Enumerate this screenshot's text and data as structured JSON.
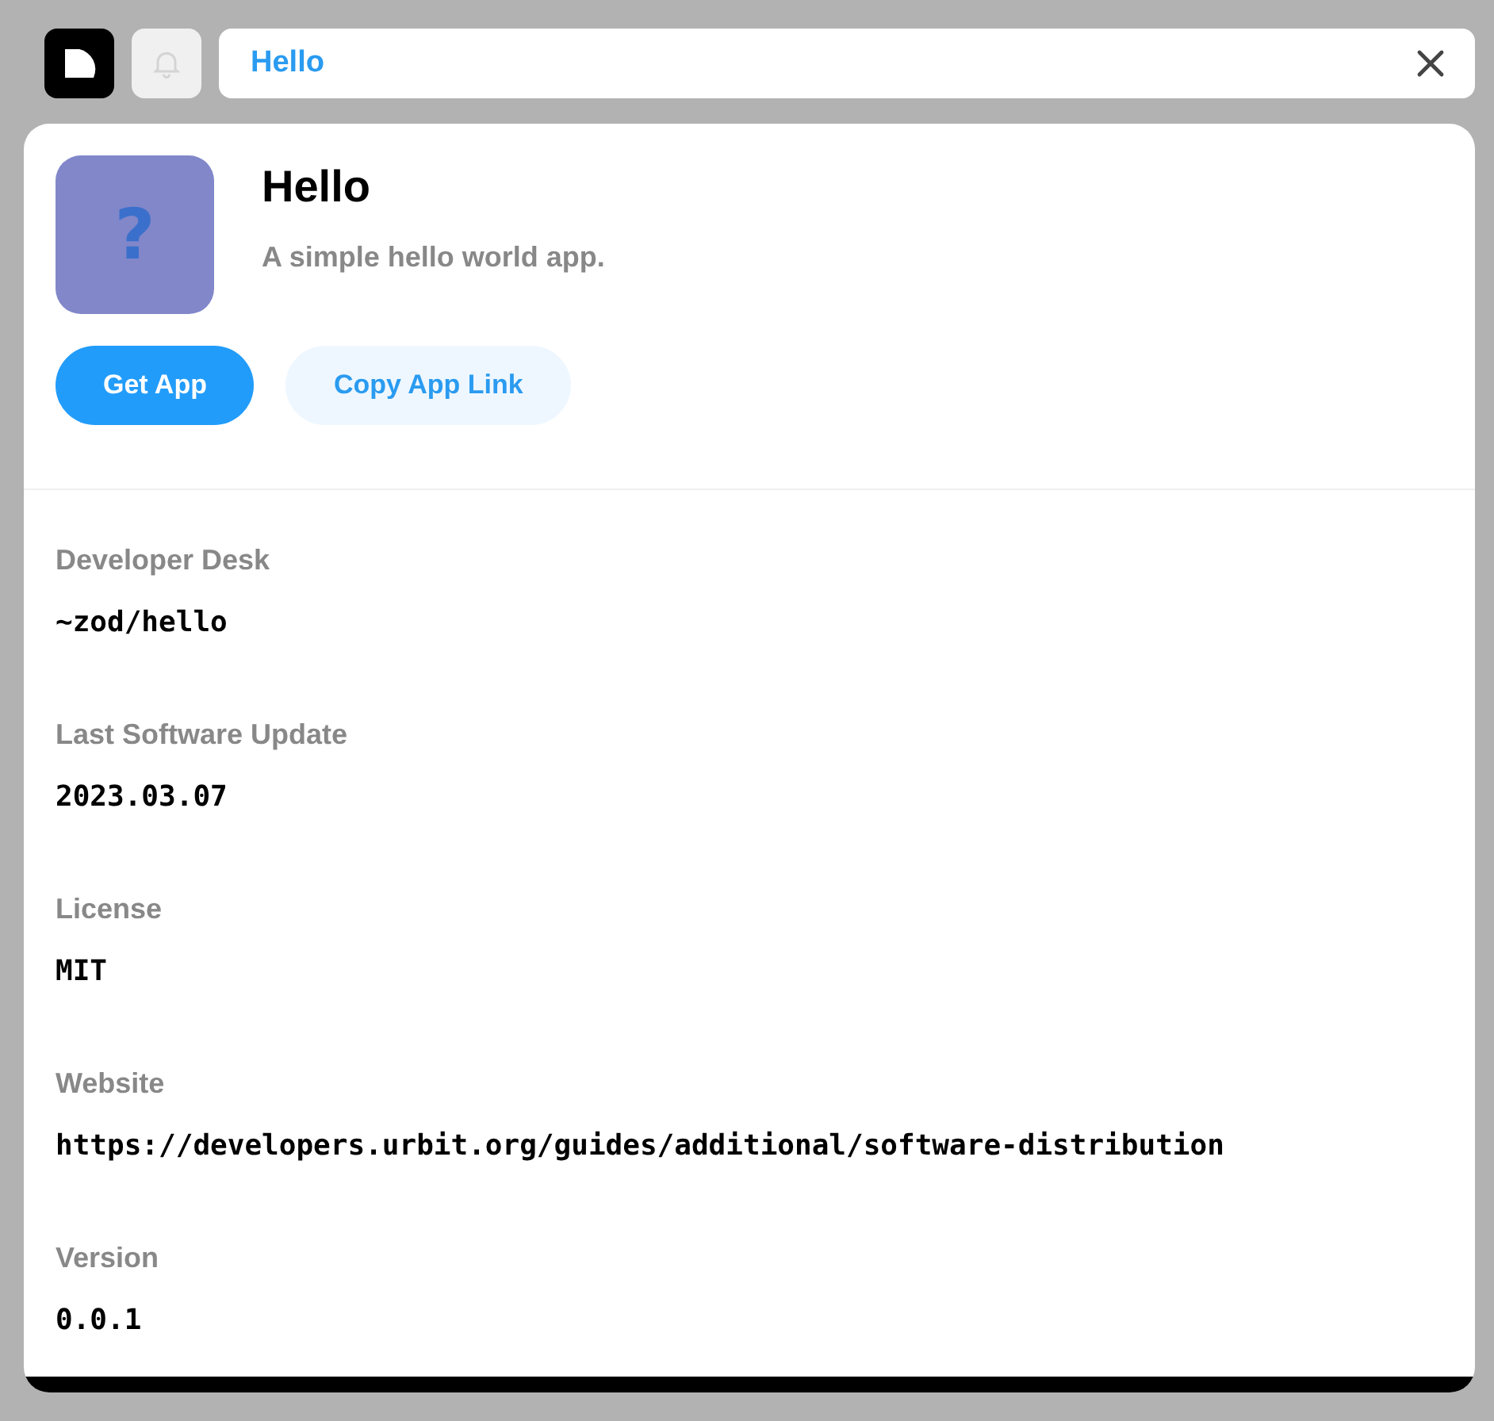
{
  "search": {
    "value": "Hello"
  },
  "app": {
    "icon_glyph": "?",
    "title": "Hello",
    "description": "A simple hello world app."
  },
  "buttons": [
    {
      "label": "Get App",
      "kind": "primary"
    },
    {
      "label": "Copy App Link",
      "kind": "secondary"
    }
  ],
  "details": [
    {
      "label": "Developer Desk",
      "value": "~zod/hello"
    },
    {
      "label": "Last Software Update",
      "value": "2023.03.07"
    },
    {
      "label": "License",
      "value": "MIT"
    },
    {
      "label": "Website",
      "value": "https://developers.urbit.org/guides/additional/software-distribution"
    },
    {
      "label": "Version",
      "value": "0.0.1"
    }
  ]
}
